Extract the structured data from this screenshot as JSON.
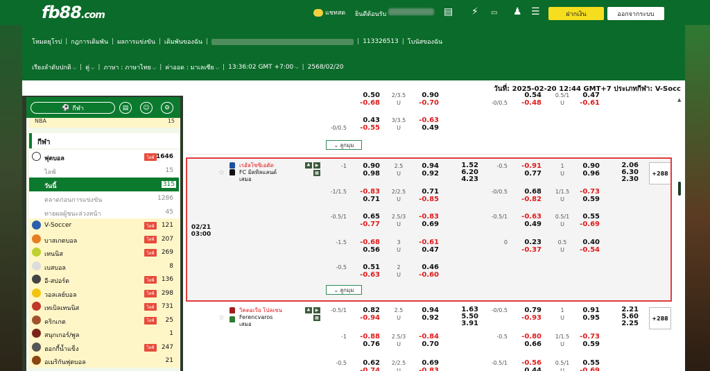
{
  "topbar": {
    "logo_main": "fb88",
    "logo_suffix": ".com",
    "chat_label": "แชทสด",
    "welcome_label": "ยินดีต้อนรับ",
    "deposit_label": "ฝากเงิน",
    "logout_label": "ออกจากระบบ",
    "icons": [
      "chat-bubble-icon",
      "bet-slip-icon",
      "lightning-icon",
      "promo-icon",
      "user-icon",
      "checklist-icon"
    ]
  },
  "nav": {
    "row1": [
      "โหมดยุโรป",
      "กฎการเดิมพัน",
      "ผลการแข่งขัน",
      "เดิมพันของฉัน",
      "113326513",
      "โบนัสของฉัน"
    ],
    "row2": {
      "sort": "เรียงลำดับปกติ",
      "pair": "คู่",
      "language": "ภาษา : ภาษาไทย",
      "odds": "ค่าออด : มาเลเซีย",
      "time": "13:36:02 GMT +7:00",
      "date": "2568/02/20"
    }
  },
  "dateline": "วันที่: 2025-02-20 12:44 GMT+7 ประเภทกีฬา: V-Socc",
  "sidebar": {
    "sports_button": "กีฬา",
    "nba": {
      "label": "NBA",
      "count": "15"
    },
    "section_title": "กีฬา",
    "live_label": "ไลฟ์",
    "football": {
      "label": "ฟุตบอล",
      "count": "1646"
    },
    "sub": [
      {
        "label": "ไลฟ์",
        "count": "15"
      },
      {
        "label": "วันนี้",
        "count": "315"
      },
      {
        "label": "ตลาดก่อนการแข่งขัน",
        "count": "1286"
      },
      {
        "label": "ทายผลผู้ชนะล่วงหน้า",
        "count": "45"
      }
    ],
    "sports": [
      {
        "label": "V-Soccer",
        "count": "121",
        "live": true,
        "color": "#2b5fae"
      },
      {
        "label": "บาสเกตบอล",
        "count": "207",
        "live": true,
        "color": "#e67e22"
      },
      {
        "label": "เทนนิส",
        "count": "269",
        "live": true,
        "color": "#c0d030"
      },
      {
        "label": "เบสบอล",
        "count": "8",
        "live": false,
        "color": "#dddddd"
      },
      {
        "label": "อี-สปอร์ต",
        "count": "136",
        "live": true,
        "color": "#444444"
      },
      {
        "label": "วอลเลย์บอล",
        "count": "298",
        "live": true,
        "color": "#f1c40f"
      },
      {
        "label": "เทเบิลเทนนิส",
        "count": "731",
        "live": true,
        "color": "#c0392b"
      },
      {
        "label": "คริกเกต",
        "count": "25",
        "live": true,
        "color": "#a0522d"
      },
      {
        "label": "สนุกเกอร์/พูล",
        "count": "1",
        "live": false,
        "color": "#7b241c"
      },
      {
        "label": "ฮอกกี้น้ำแข็ง",
        "count": "247",
        "live": true,
        "color": "#555555"
      },
      {
        "label": "อเมริกันฟุตบอล",
        "count": "21",
        "live": false,
        "color": "#8b4513"
      }
    ]
  },
  "main": {
    "more_label": "ลูกมุม",
    "top_partial": {
      "r1": {
        "hdp": "",
        "home": "-0.68",
        "home_top": "0.50",
        "ou": "2/3.5",
        "ou_u": "U",
        "over": "-0.70",
        "over_top": "0.90",
        "hdp2": "-0/0.5",
        "h2": "-0.48",
        "h2_top": "0.54",
        "ou2": "0.5/1",
        "ou2_u": "U",
        "o2": "-0.61",
        "o2_top": "0.47"
      },
      "r2": {
        "hdp": "-0/0.5",
        "home": "0.43",
        "away": "-0.55",
        "ou": "3/3.5",
        "ou_u": "U",
        "over": "-0.63",
        "under": "0.49"
      }
    },
    "match1": {
      "date": "02/21",
      "time": "03:00",
      "team1": "เรอัลโซซิเอดัด",
      "team2": "FC มิดทิลแลนด์",
      "draw": "เสมอ",
      "x12": [
        "1.52",
        "6.20",
        "4.23"
      ],
      "x12_ht": [
        "2.06",
        "6.30",
        "2.30"
      ],
      "plus": "+288",
      "lines": [
        {
          "hdp": "-1",
          "h": "0.90",
          "a": "0.98",
          "ou": "2.5",
          "u": "U",
          "o": "0.94",
          "un": "0.92",
          "hdp2": "-0.5",
          "h2": "-0.91",
          "a2": "0.77",
          "ou2": "1",
          "u2": "U",
          "o2": "0.90",
          "un2": "0.96"
        },
        {
          "hdp": "-1/1.5",
          "h": "-0.83",
          "a": "0.71",
          "ou": "2/2.5",
          "u": "U",
          "o": "0.71",
          "un": "-0.85",
          "hdp2": "-0/0.5",
          "h2": "0.68",
          "a2": "-0.82",
          "ou2": "1/1.5",
          "u2": "U",
          "o2": "-0.73",
          "un2": "0.59"
        },
        {
          "hdp": "-0.5/1",
          "h": "0.65",
          "a": "-0.77",
          "ou": "2.5/3",
          "u": "U",
          "o": "-0.83",
          "un": "0.69",
          "hdp2": "-0.5/1",
          "h2": "-0.63",
          "a2": "0.49",
          "ou2": "0.5/1",
          "u2": "U",
          "o2": "0.55",
          "un2": "-0.69"
        },
        {
          "hdp": "-1.5",
          "h": "-0.68",
          "a": "0.56",
          "ou": "3",
          "u": "U",
          "o": "-0.61",
          "un": "0.47",
          "hdp2": "0",
          "h2": "0.23",
          "a2": "-0.37",
          "ou2": "0.5",
          "u2": "U",
          "o2": "0.40",
          "un2": "-0.54"
        },
        {
          "hdp": "-0.5",
          "h": "0.51",
          "a": "-0.63",
          "ou": "2",
          "u": "U",
          "o": "0.46",
          "un": "-0.60",
          "hdp2": "",
          "h2": "",
          "a2": "",
          "ou2": "",
          "u2": "",
          "o2": "",
          "un2": ""
        }
      ]
    },
    "match2": {
      "team1": "วิคตอเรีย โปลเซน",
      "team2": "Ferencvaros",
      "draw": "เสมอ",
      "x12": [
        "1.63",
        "5.50",
        "3.91"
      ],
      "x12_ht": [
        "2.21",
        "5.60",
        "2.25"
      ],
      "plus": "+288",
      "lines": [
        {
          "hdp": "-0.5/1",
          "h": "0.82",
          "a": "-0.94",
          "ou": "2.5",
          "u": "U",
          "o": "0.94",
          "un": "0.92",
          "hdp2": "-0/0.5",
          "h2": "0.79",
          "a2": "-0.93",
          "ou2": "1",
          "u2": "U",
          "o2": "0.91",
          "un2": "0.95"
        },
        {
          "hdp": "-1",
          "h": "-0.88",
          "a": "0.76",
          "ou": "2.5/3",
          "u": "U",
          "o": "-0.84",
          "un": "0.70",
          "hdp2": "-0.5",
          "h2": "-0.80",
          "a2": "0.66",
          "ou2": "1/1.5",
          "u2": "U",
          "o2": "-0.73",
          "un2": "0.59"
        },
        {
          "hdp": "-0.5",
          "h": "0.62",
          "a": "-0.74",
          "ou": "2/2.5",
          "u": "U",
          "o": "0.69",
          "un": "-0.83",
          "hdp2": "-0.5/1",
          "h2": "-0.56",
          "a2": "0.44",
          "ou2": "0.5/1",
          "u2": "U",
          "o2": "0.55",
          "un2": "-0.69"
        }
      ]
    }
  }
}
